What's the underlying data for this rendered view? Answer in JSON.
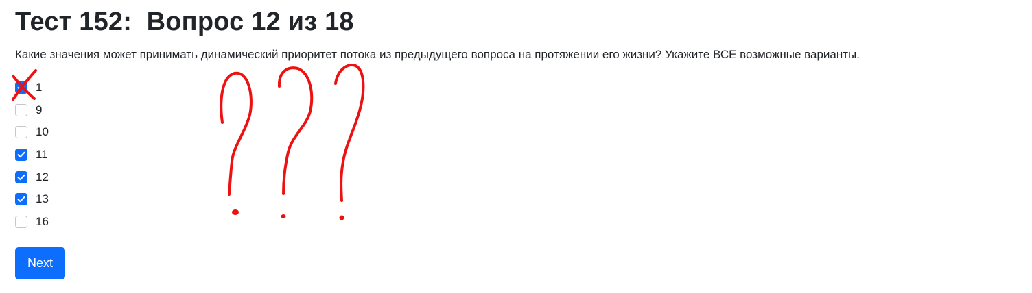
{
  "quiz": {
    "title": "Тест 152:  Вопрос 12 из 18",
    "question": "Какие значения может принимать динамический приоритет потока из предыдущего вопроса на протяжении его жизни? Укажите ВСЕ возможные варианты.",
    "options": [
      {
        "label": "1",
        "checked": true
      },
      {
        "label": "9",
        "checked": false
      },
      {
        "label": "10",
        "checked": false
      },
      {
        "label": "11",
        "checked": true
      },
      {
        "label": "12",
        "checked": true
      },
      {
        "label": "13",
        "checked": true
      },
      {
        "label": "16",
        "checked": false
      }
    ],
    "next_label": "Next"
  },
  "annotations": {
    "color": "#ee1111",
    "marks": [
      "cross-mark-on-option-1",
      "question-mark",
      "question-mark",
      "question-mark"
    ]
  },
  "colors": {
    "accent": "#0d6efd",
    "text": "#212529",
    "checkbox_border": "#c4c8cc"
  }
}
